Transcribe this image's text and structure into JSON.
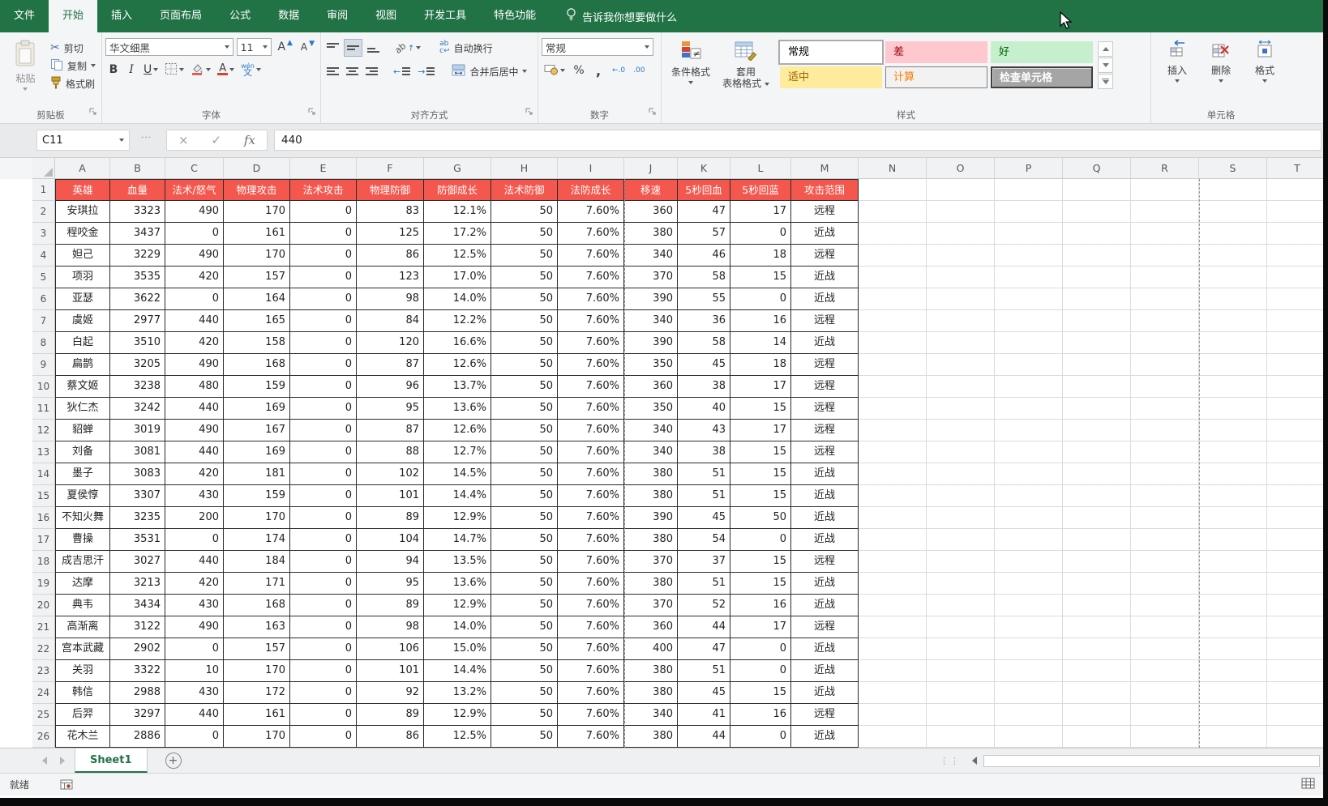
{
  "titlebar": {
    "tabs": [
      {
        "label": "文件"
      },
      {
        "label": "开始"
      },
      {
        "label": "插入"
      },
      {
        "label": "页面布局"
      },
      {
        "label": "公式"
      },
      {
        "label": "数据"
      },
      {
        "label": "审阅"
      },
      {
        "label": "视图"
      },
      {
        "label": "开发工具"
      },
      {
        "label": "特色功能"
      }
    ],
    "active_tab": "开始",
    "tell_me": "告诉我你想要做什么",
    "bar_color": "#217346"
  },
  "ribbon": {
    "clipboard": {
      "group_label": "剪贴板",
      "paste": "粘贴",
      "cut": "剪切",
      "copy": "复制",
      "format_painter": "格式刷"
    },
    "font": {
      "group_label": "字体",
      "font_name": "华文细黑",
      "font_size": "11",
      "bold": "B",
      "italic": "I",
      "underline": "U",
      "increase_font": "A",
      "decrease_font": "A",
      "phonetic": "文",
      "phonetic_mark": "wén"
    },
    "alignment": {
      "group_label": "对齐方式",
      "orientation": "ab",
      "wrap_text": "自动换行",
      "merge_center": "合并后居中"
    },
    "number": {
      "group_label": "数字",
      "format": "常规",
      "percent": "%",
      "comma": ",",
      "inc_decimal": "←.0",
      "dec_decimal": ".00"
    },
    "styles": {
      "group_label": "样式",
      "conditional_formatting": "条件格式",
      "format_as_table_line1": "套用",
      "format_as_table_line2": "表格格式",
      "cell_styles": [
        {
          "label": "常规",
          "bg": "#ffffff",
          "fg": "#000000"
        },
        {
          "label": "差",
          "bg": "#ffc7ce",
          "fg": "#9c0006"
        },
        {
          "label": "好",
          "bg": "#c6efce",
          "fg": "#006100"
        },
        {
          "label": "适中",
          "bg": "#ffeb9c",
          "fg": "#9c6500"
        },
        {
          "label": "计算",
          "bg": "#f2f2f2",
          "fg": "#fa7d00"
        },
        {
          "label": "检查单元格",
          "bg": "#a5a5a5",
          "fg": "#ffffff"
        }
      ]
    },
    "cells": {
      "group_label": "单元格",
      "insert": "插入",
      "delete": "删除",
      "format": "格式"
    }
  },
  "formula_bar": {
    "name_box": "C11",
    "cancel": "×",
    "enter": "✓",
    "fx": "fx",
    "value": "440"
  },
  "grid": {
    "columns": [
      "A",
      "B",
      "C",
      "D",
      "E",
      "F",
      "G",
      "H",
      "I",
      "J",
      "K",
      "L",
      "M",
      "N",
      "O",
      "P",
      "Q",
      "R",
      "S",
      "T"
    ],
    "row_count": 26,
    "table": {
      "header_bg": "#f4574e",
      "header_fg": "#ffffff",
      "headers": [
        "英雄",
        "血量",
        "法术/怒气",
        "物理攻击",
        "法术攻击",
        "物理防御",
        "防御成长",
        "法术防御",
        "法防成长",
        "移速",
        "5秒回血",
        "5秒回蓝",
        "攻击范围"
      ],
      "rows": [
        [
          "安琪拉",
          "3323",
          "490",
          "170",
          "0",
          "83",
          "12.1%",
          "50",
          "7.60%",
          "360",
          "47",
          "17",
          "远程"
        ],
        [
          "程咬金",
          "3437",
          "0",
          "161",
          "0",
          "125",
          "17.2%",
          "50",
          "7.60%",
          "380",
          "57",
          "0",
          "近战"
        ],
        [
          "妲己",
          "3229",
          "490",
          "170",
          "0",
          "86",
          "12.5%",
          "50",
          "7.60%",
          "340",
          "46",
          "18",
          "远程"
        ],
        [
          "项羽",
          "3535",
          "420",
          "157",
          "0",
          "123",
          "17.0%",
          "50",
          "7.60%",
          "370",
          "58",
          "15",
          "近战"
        ],
        [
          "亚瑟",
          "3622",
          "0",
          "164",
          "0",
          "98",
          "14.0%",
          "50",
          "7.60%",
          "390",
          "55",
          "0",
          "近战"
        ],
        [
          "虞姬",
          "2977",
          "440",
          "165",
          "0",
          "84",
          "12.2%",
          "50",
          "7.60%",
          "340",
          "36",
          "16",
          "远程"
        ],
        [
          "白起",
          "3510",
          "420",
          "158",
          "0",
          "120",
          "16.6%",
          "50",
          "7.60%",
          "390",
          "58",
          "14",
          "近战"
        ],
        [
          "扁鹊",
          "3205",
          "490",
          "168",
          "0",
          "87",
          "12.6%",
          "50",
          "7.60%",
          "350",
          "45",
          "18",
          "远程"
        ],
        [
          "蔡文姬",
          "3238",
          "480",
          "159",
          "0",
          "96",
          "13.7%",
          "50",
          "7.60%",
          "360",
          "38",
          "17",
          "远程"
        ],
        [
          "狄仁杰",
          "3242",
          "440",
          "169",
          "0",
          "95",
          "13.6%",
          "50",
          "7.60%",
          "350",
          "40",
          "15",
          "远程"
        ],
        [
          "貂蝉",
          "3019",
          "490",
          "167",
          "0",
          "87",
          "12.6%",
          "50",
          "7.60%",
          "340",
          "43",
          "17",
          "远程"
        ],
        [
          "刘备",
          "3081",
          "440",
          "169",
          "0",
          "88",
          "12.7%",
          "50",
          "7.60%",
          "340",
          "38",
          "15",
          "远程"
        ],
        [
          "墨子",
          "3083",
          "420",
          "181",
          "0",
          "102",
          "14.5%",
          "50",
          "7.60%",
          "380",
          "51",
          "15",
          "近战"
        ],
        [
          "夏侯惇",
          "3307",
          "430",
          "159",
          "0",
          "101",
          "14.4%",
          "50",
          "7.60%",
          "380",
          "51",
          "15",
          "近战"
        ],
        [
          "不知火舞",
          "3235",
          "200",
          "170",
          "0",
          "89",
          "12.9%",
          "50",
          "7.60%",
          "390",
          "45",
          "50",
          "近战"
        ],
        [
          "曹操",
          "3531",
          "0",
          "174",
          "0",
          "104",
          "14.7%",
          "50",
          "7.60%",
          "380",
          "54",
          "0",
          "近战"
        ],
        [
          "成吉思汗",
          "3027",
          "440",
          "184",
          "0",
          "94",
          "13.5%",
          "50",
          "7.60%",
          "370",
          "37",
          "15",
          "远程"
        ],
        [
          "达摩",
          "3213",
          "420",
          "171",
          "0",
          "95",
          "13.6%",
          "50",
          "7.60%",
          "380",
          "51",
          "15",
          "近战"
        ],
        [
          "典韦",
          "3434",
          "430",
          "168",
          "0",
          "89",
          "12.9%",
          "50",
          "7.60%",
          "370",
          "52",
          "16",
          "近战"
        ],
        [
          "高渐离",
          "3122",
          "490",
          "163",
          "0",
          "98",
          "14.0%",
          "50",
          "7.60%",
          "360",
          "44",
          "17",
          "远程"
        ],
        [
          "宫本武藏",
          "2902",
          "0",
          "157",
          "0",
          "106",
          "15.0%",
          "50",
          "7.60%",
          "400",
          "47",
          "0",
          "近战"
        ],
        [
          "关羽",
          "3322",
          "10",
          "170",
          "0",
          "101",
          "14.4%",
          "50",
          "7.60%",
          "380",
          "51",
          "0",
          "近战"
        ],
        [
          "韩信",
          "2988",
          "430",
          "172",
          "0",
          "92",
          "13.2%",
          "50",
          "7.60%",
          "380",
          "45",
          "15",
          "近战"
        ],
        [
          "后羿",
          "3297",
          "440",
          "161",
          "0",
          "89",
          "12.9%",
          "50",
          "7.60%",
          "340",
          "41",
          "16",
          "远程"
        ],
        [
          "花木兰",
          "2886",
          "0",
          "170",
          "0",
          "86",
          "12.5%",
          "50",
          "7.60%",
          "380",
          "44",
          "0",
          "近战"
        ]
      ]
    }
  },
  "sheet_bar": {
    "sheet_name": "Sheet1"
  },
  "status_bar": {
    "status": "就绪"
  }
}
